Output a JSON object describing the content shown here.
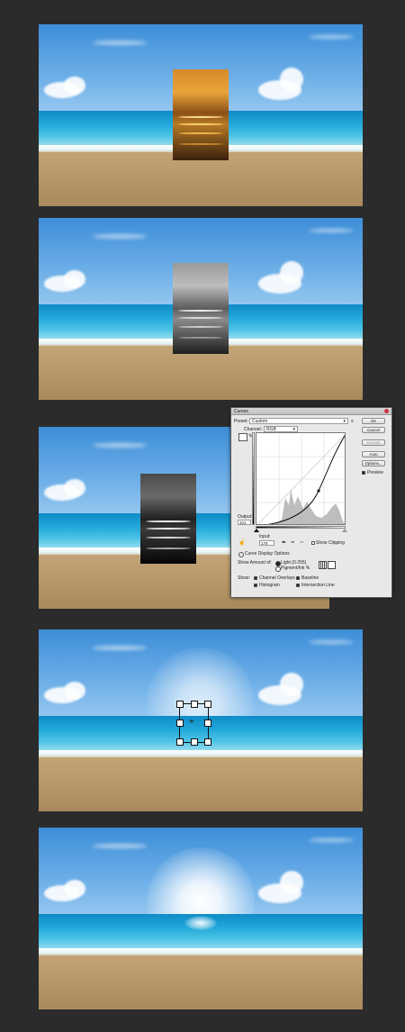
{
  "steps": [
    {
      "label": "sunset-photo-placed"
    },
    {
      "label": "photo-desaturated"
    },
    {
      "label": "curves-adjusted"
    },
    {
      "label": "photo-transformed"
    },
    {
      "label": "sun-glow-result"
    }
  ],
  "curves": {
    "title": "Curves",
    "preset_label": "Preset:",
    "preset_value": "Custom",
    "channel_label": "Channel:",
    "channel_value": "RGB",
    "buttons": {
      "ok": "OK",
      "cancel": "Cancel",
      "smooth": "Smooth",
      "auto": "Auto",
      "options": "Options..."
    },
    "preview_label": "Preview",
    "preview_checked": true,
    "output_label": "Output:",
    "output_value": "101",
    "input_label": "Input:",
    "input_value": "176",
    "show_clipping_label": "Show Clipping",
    "curve_display_options_label": "Curve Display Options",
    "show_amount_label": "Show Amount of:",
    "light_label": "Light  (0-255)",
    "pigment_label": "Pigment/Ink %",
    "show_label": "Show:",
    "channel_overlays_label": "Channel Overlays",
    "baseline_label": "Baseline",
    "histogram_label": "Histogram",
    "intersection_line_label": "Intersection Line",
    "accent_color": "#2c5fa8"
  }
}
